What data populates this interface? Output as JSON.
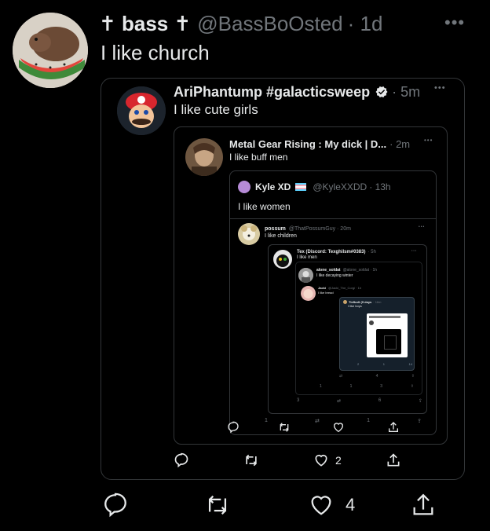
{
  "tweet": {
    "display_name": "✝ bass ✝",
    "handle": "@BassBoOsted",
    "time": "· 1d",
    "text": "I like church",
    "replies": "",
    "retweets": "",
    "likes": "4"
  },
  "quote1": {
    "display_name": "AriPhantump #galacticsweep",
    "time": "· 5m",
    "text": "I like cute girls",
    "likes": "2"
  },
  "quote2": {
    "display_name": "Metal Gear Rising : My dick | D...",
    "time": "· 2m",
    "text": "I like buff men"
  },
  "quote3": {
    "display_name": "Kyle XD",
    "handle": "@KyleXXDD",
    "time": "· 13h",
    "text": "I like women"
  },
  "quote4": {
    "display_name": "possum",
    "handle": "@ThatPossumGuy · 20m",
    "text": "I like children",
    "replies": "1",
    "likes": "1"
  },
  "quote5": {
    "display_name": "Tex (Discord: Texghilsm#0383)",
    "time": "· 5h",
    "text": "I like men",
    "replies": "3",
    "likes": "6"
  },
  "quote6": {
    "display_name": "alone_soldat",
    "handle": "@alone_soldat · 1h",
    "text": "I like decaying winter",
    "replies": "1",
    "retweets": "1",
    "likes": "3"
  },
  "quote7": {
    "display_name": "Jacki",
    "handle": "@Jacki_The_Corgi · 1h",
    "text": "I like bread",
    "likes": "4"
  },
  "quote8": {
    "display_name": "Tiefbolt (9 days",
    "time": "· 16m",
    "text": "I like boys",
    "replies": "2",
    "retweets": "1",
    "likes": "14"
  },
  "colors": {
    "background": "#000000",
    "text": "#e7e9ea",
    "secondary": "#71767b",
    "border": "#333639",
    "verified": "#e7e9ea"
  },
  "icons": [
    "reply-icon",
    "retweet-icon",
    "like-icon",
    "share-icon",
    "more-icon",
    "verified-icon",
    "trans-flag-icon"
  ]
}
